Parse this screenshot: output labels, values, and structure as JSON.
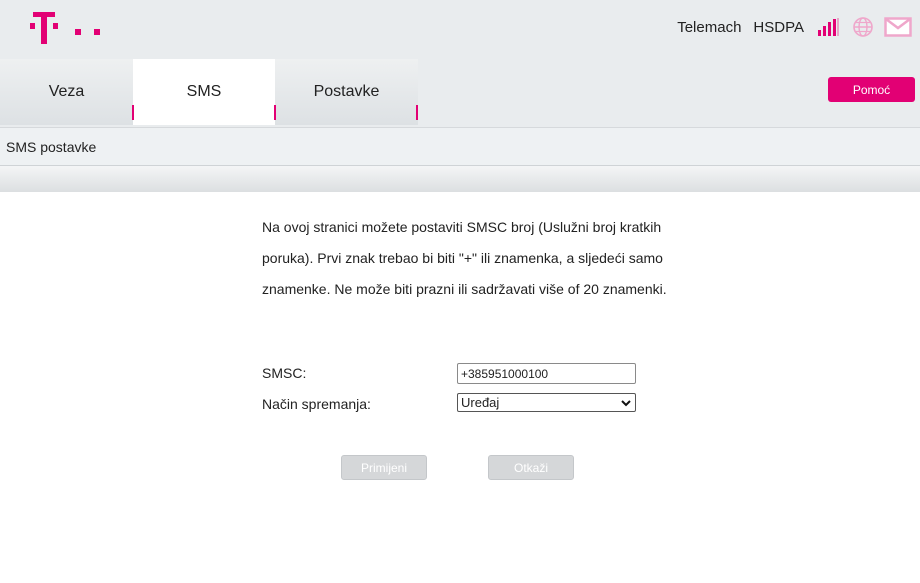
{
  "header": {
    "carrier": "Telemach",
    "network_type": "HSDPA",
    "signal_bars": 4,
    "brand_color": "#e20074"
  },
  "nav": {
    "tabs": [
      {
        "label": "Veza",
        "active": false
      },
      {
        "label": "SMS",
        "active": true
      },
      {
        "label": "Postavke",
        "active": false
      }
    ],
    "help_label": "Pomoć"
  },
  "page": {
    "section_title": "SMS postavke",
    "description": "Na ovoj stranici možete postaviti SMSC broj (Uslužni broj kratkih poruka). Prvi znak trebao bi biti \"+\" ili znamenka, a sljedeći samo znamenke. Ne može biti prazni ili sadržavati više of 20 znamenki."
  },
  "form": {
    "smsc_label": "SMSC:",
    "smsc_value": "+385951000100",
    "mode_label": "Način spremanja:",
    "mode_value": "Uređaj"
  },
  "buttons": {
    "apply": "Primijeni",
    "cancel": "Otkaži"
  }
}
